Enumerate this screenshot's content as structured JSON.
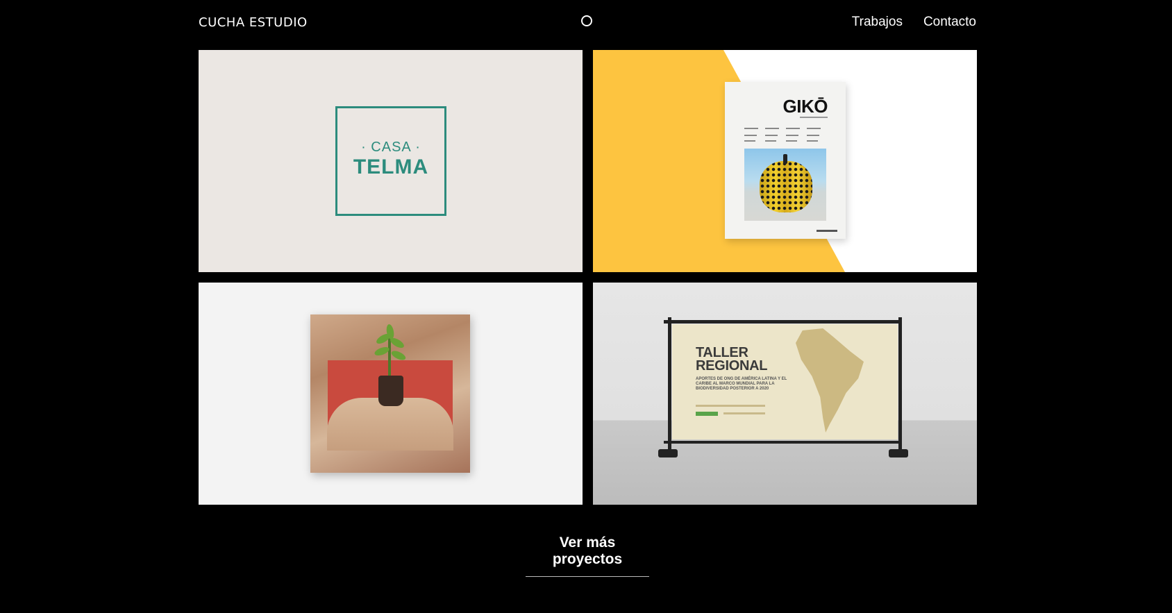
{
  "header": {
    "logo": "CUCHA ESTUDIO",
    "nav": [
      {
        "label": "Trabajos"
      },
      {
        "label": "Contacto"
      }
    ]
  },
  "projects": [
    {
      "name": "casa-telma",
      "logo_top": "· CASA ·",
      "logo_main": "TELMA",
      "brand_color": "#2c8c7d",
      "background": "#ebe7e3"
    },
    {
      "name": "giko",
      "title": "GIKŌ",
      "accent": "#fdc440"
    },
    {
      "name": "collage"
    },
    {
      "name": "taller-regional",
      "title": "TALLER REGIONAL",
      "text": "APORTES DE ONG DE AMÉRICA LATINA Y EL CARIBE AL MARCO MUNDIAL PARA LA BIODIVERSIDAD POSTERIOR A 2020"
    }
  ],
  "footer": {
    "more_label": "Ver más proyectos"
  }
}
